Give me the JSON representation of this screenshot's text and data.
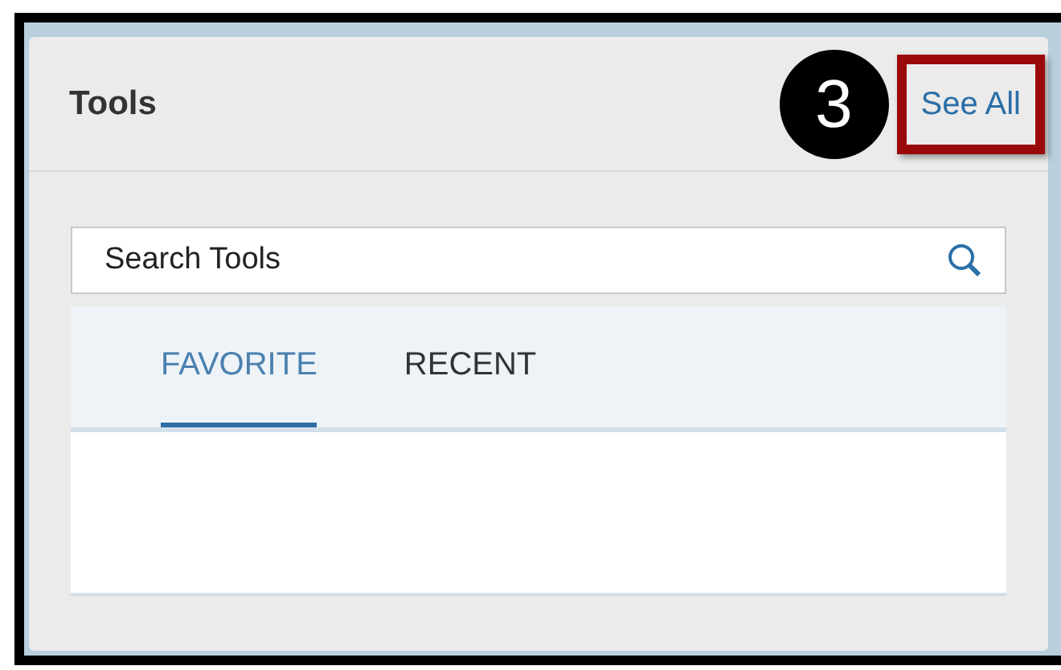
{
  "panel": {
    "title": "Tools",
    "step_marker": "3",
    "see_all": {
      "label": "See All",
      "highlighted": true
    }
  },
  "search": {
    "placeholder": "Search Tools"
  },
  "tabs": [
    {
      "label": "FAVORITE",
      "selected": true
    },
    {
      "label": "RECENT",
      "selected": false
    }
  ]
}
